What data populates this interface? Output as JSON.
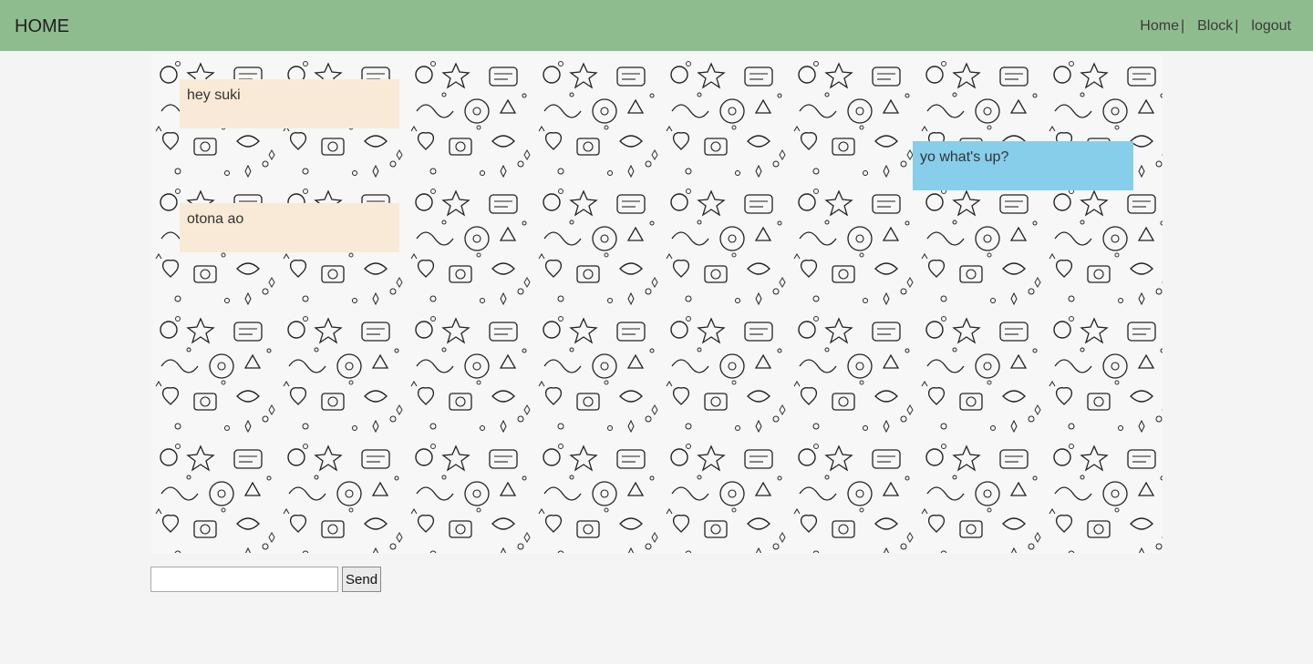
{
  "navbar": {
    "brand": "HOME",
    "links": [
      {
        "label": "Home",
        "separator": "|"
      },
      {
        "label": "Block",
        "separator": "|"
      },
      {
        "label": "logout"
      }
    ],
    "color": "#8fbc8f"
  },
  "chat": {
    "messages": [
      {
        "text": "hey suki",
        "direction": "incoming",
        "color": "#f9ead7"
      },
      {
        "text": "yo what's up?",
        "direction": "outgoing",
        "color": "#87ceeb"
      },
      {
        "text": "otona ao",
        "direction": "incoming",
        "color": "#f9ead7"
      }
    ]
  },
  "composer": {
    "value": "",
    "placeholder": "",
    "send_label": "Send"
  }
}
